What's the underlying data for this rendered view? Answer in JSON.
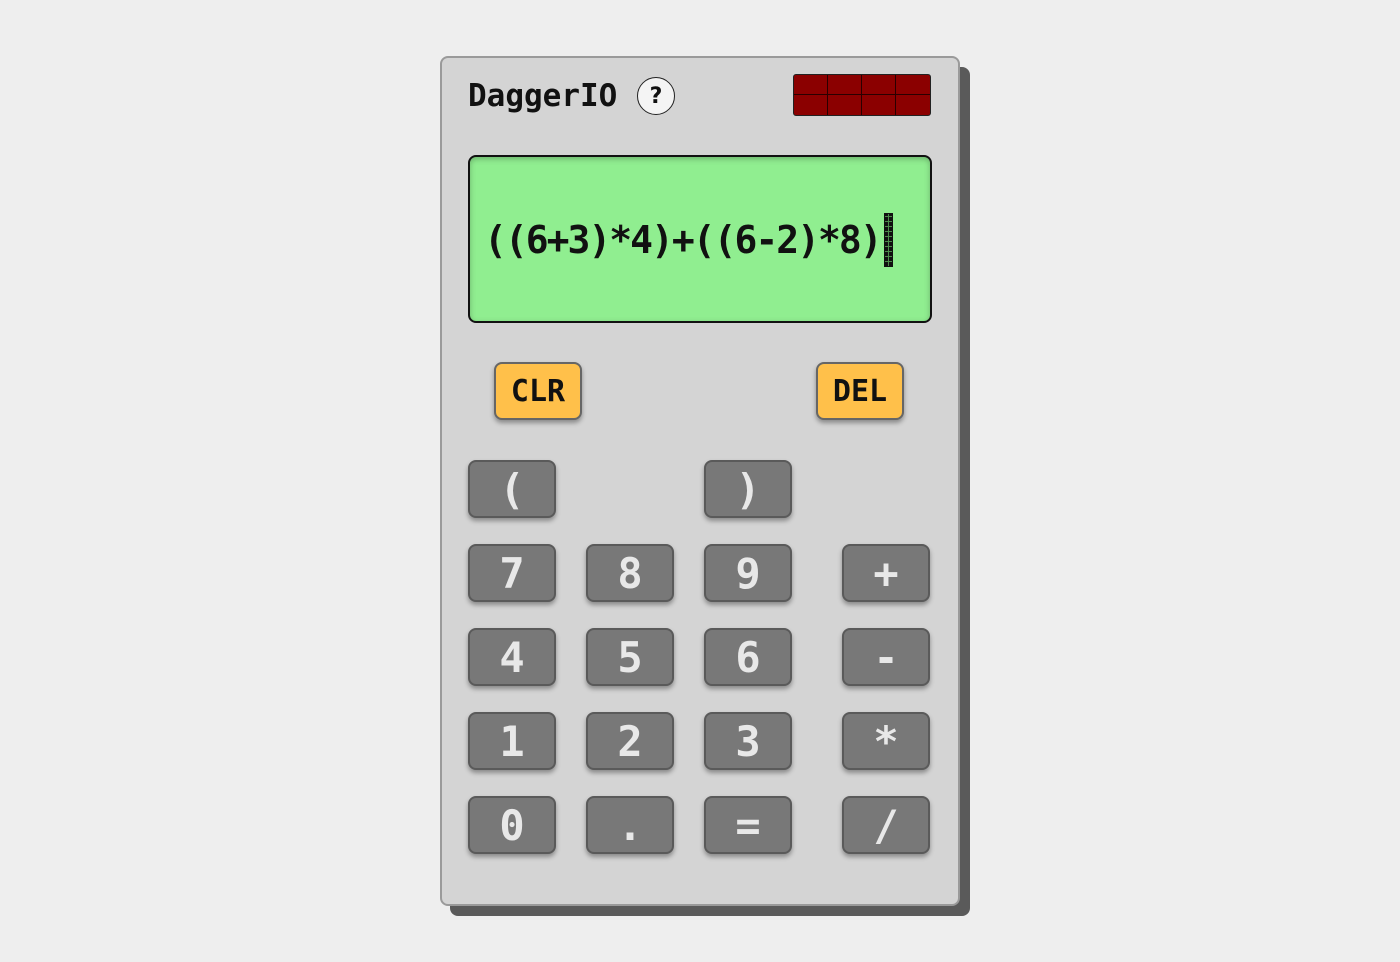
{
  "app": {
    "title": "DaggerIO",
    "help_label": "?"
  },
  "display": {
    "expression": "((6+3)*4)+((6-2)*8)"
  },
  "function_keys": {
    "clear_label": "CLR",
    "delete_label": "DEL"
  },
  "keys": {
    "paren_open": "(",
    "paren_close": ")",
    "seven": "7",
    "eight": "8",
    "nine": "9",
    "plus": "+",
    "four": "4",
    "five": "5",
    "six": "6",
    "minus": "-",
    "one": "1",
    "two": "2",
    "three": "3",
    "multiply": "*",
    "zero": "0",
    "decimal": ".",
    "equals": "=",
    "divide": "/"
  },
  "colors": {
    "body": "#d4d4d4",
    "screen": "#90ee90",
    "solar_panel": "#8b0000",
    "key": "#787878",
    "function_key": "#ffc04a"
  }
}
